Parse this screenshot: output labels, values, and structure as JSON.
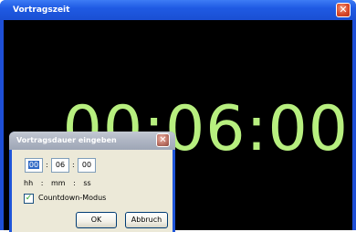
{
  "main_window": {
    "title": "Vortragszeit",
    "close_glyph": "✕",
    "timer_display": "00:06:00",
    "timer_color": "#b7ef7f"
  },
  "dialog": {
    "title": "Vortragsdauer eingeben",
    "close_glyph": "✕",
    "fields": {
      "hours": "00",
      "minutes": "06",
      "seconds": "00"
    },
    "separator": ":",
    "units": {
      "hours": "hh",
      "minutes": "mm",
      "seconds": "ss"
    },
    "countdown_checkbox": {
      "checked": true,
      "check_glyph": "✓",
      "label": "Countdown-Modus"
    },
    "ok_label": "OK",
    "cancel_label": "Abbruch"
  },
  "icons": {
    "main_close": "close-icon",
    "dialog_close": "close-icon",
    "checkbox": "checkmark-icon"
  }
}
